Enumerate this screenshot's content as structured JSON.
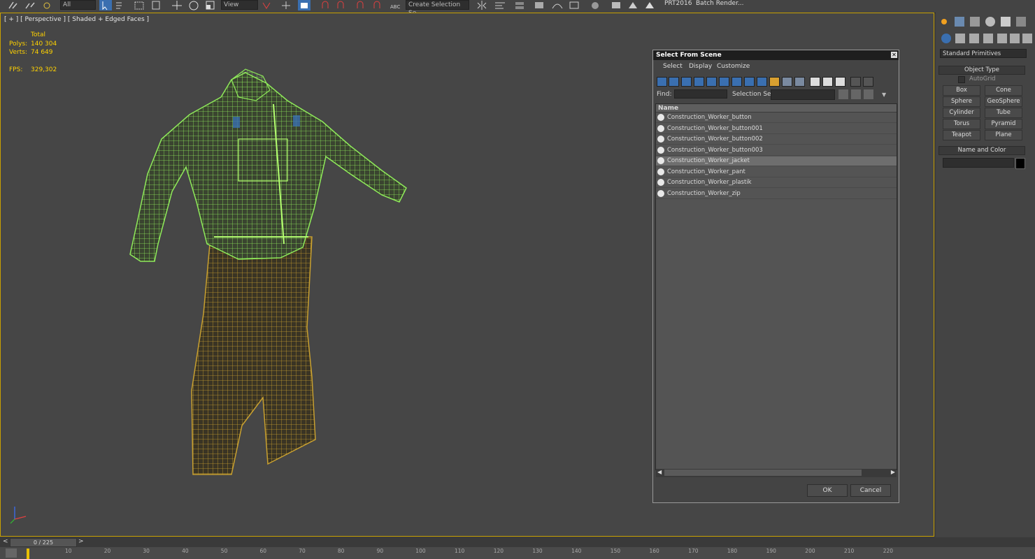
{
  "toolbar": {
    "selection_filter": "All",
    "ref_coord": "View",
    "named_selection_placeholder": "Create Selection Se",
    "prt_label": "PRT2016",
    "batch_render_label": "Batch Render..."
  },
  "viewport": {
    "label": "[ + ] [ Perspective ] [ Shaded + Edged Faces ]",
    "stats": {
      "total_label": "Total",
      "polys_label": "Polys:",
      "polys_value": "140 304",
      "verts_label": "Verts:",
      "verts_value": "74 649",
      "fps_label": "FPS:",
      "fps_value": "329,302"
    },
    "colors": {
      "jacket_wire": "#8fea5a",
      "pants_wire": "#c8a030",
      "stat_color": "#ffd200",
      "active_border": "#c8a000"
    }
  },
  "dialog": {
    "title": "Select From Scene",
    "menu": [
      "Select",
      "Display",
      "Customize"
    ],
    "find_label": "Find:",
    "selection_set_label": "Selection Set:",
    "column_header": "Name",
    "items": [
      {
        "name": "Construction_Worker_button",
        "selected": false
      },
      {
        "name": "Construction_Worker_button001",
        "selected": false
      },
      {
        "name": "Construction_Worker_button002",
        "selected": false
      },
      {
        "name": "Construction_Worker_button003",
        "selected": false
      },
      {
        "name": "Construction_Worker_jacket",
        "selected": true
      },
      {
        "name": "Construction_Worker_pant",
        "selected": false
      },
      {
        "name": "Construction_Worker_plastik",
        "selected": false
      },
      {
        "name": "Construction_Worker_zip",
        "selected": false
      }
    ],
    "ok_label": "OK",
    "cancel_label": "Cancel"
  },
  "command_panel": {
    "dropdown": "Standard Primitives",
    "object_type_header": "Object Type",
    "autogrid_label": "AutoGrid",
    "buttons": [
      "Box",
      "Cone",
      "Sphere",
      "GeoSphere",
      "Cylinder",
      "Tube",
      "Torus",
      "Pyramid",
      "Teapot",
      "Plane"
    ],
    "name_color_header": "Name and Color",
    "swatch_color": "#000000"
  },
  "timeline": {
    "frame_counter": "0 / 225",
    "prev_label": "<",
    "next_label": ">",
    "ticks": [
      "10",
      "20",
      "30",
      "40",
      "50",
      "60",
      "70",
      "80",
      "90",
      "100",
      "110",
      "120",
      "130",
      "140",
      "150",
      "160",
      "170",
      "180",
      "190",
      "200",
      "210",
      "220"
    ]
  }
}
